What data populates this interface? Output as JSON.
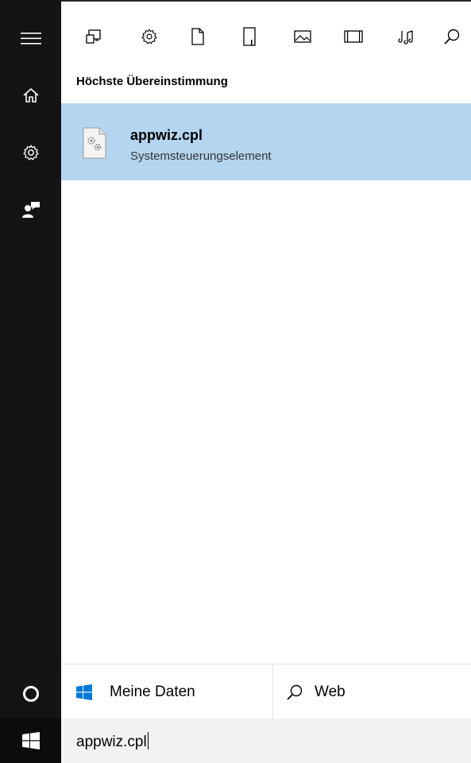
{
  "filters": {
    "icons": [
      "apps-icon",
      "settings-icon",
      "documents-icon",
      "folders-icon",
      "photos-icon",
      "videos-icon",
      "music-icon",
      "search-icon"
    ]
  },
  "results": {
    "section_heading": "Höchste Übereinstimmung",
    "best_match": {
      "title": "appwiz.cpl",
      "subtitle": "Systemsteuerungselement",
      "icon": "control-panel-item-icon"
    }
  },
  "bottom_tabs": {
    "my_data_label": "Meine Daten",
    "web_label": "Web"
  },
  "search": {
    "query": "appwiz.cpl"
  },
  "colors": {
    "rail": "#141414",
    "selected_result": "#b4d5f0",
    "windows_blue": "#0078d7"
  }
}
